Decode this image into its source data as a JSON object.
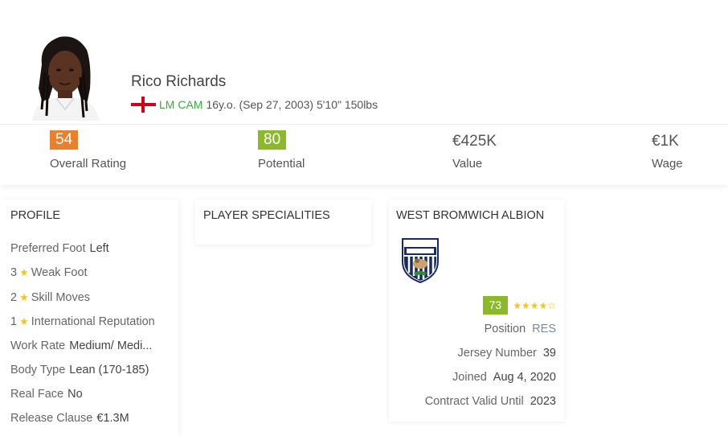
{
  "player": {
    "name": "Rico Richards",
    "positions": "LM CAM",
    "details": "16y.o. (Sep 27, 2003) 5'10\" 150lbs",
    "nationality_flag": "england-flag-icon"
  },
  "stats": {
    "overall": {
      "value": "54",
      "label": "Overall Rating",
      "color": "#e8812f"
    },
    "potential": {
      "value": "80",
      "label": "Potential",
      "color": "#8cb82c"
    },
    "value": {
      "value": "€425K",
      "label": "Value"
    },
    "wage": {
      "value": "€1K",
      "label": "Wage"
    }
  },
  "profile": {
    "title": "PROFILE",
    "preferred_foot": {
      "label": "Preferred Foot",
      "value": "Left"
    },
    "weak_foot": {
      "num": "3",
      "label": "Weak Foot"
    },
    "skill_moves": {
      "num": "2",
      "label": "Skill Moves"
    },
    "intl_rep": {
      "num": "1",
      "label": "International Reputation"
    },
    "work_rate": {
      "label": "Work Rate",
      "value": "Medium/ Medi..."
    },
    "body_type": {
      "label": "Body Type",
      "value": "Lean (170-185)"
    },
    "real_face": {
      "label": "Real Face",
      "value": "No"
    },
    "release_clause": {
      "label": "Release Clause",
      "value": "€1.3M"
    }
  },
  "specialities": {
    "title": "PLAYER SPECIALITIES"
  },
  "club": {
    "title": "WEST BROMWICH ALBION",
    "rating": "73",
    "stars": "★★★★☆",
    "position": {
      "label": "Position",
      "value": "RES"
    },
    "jersey": {
      "label": "Jersey Number",
      "value": "39"
    },
    "joined": {
      "label": "Joined",
      "value": "Aug 4, 2020"
    },
    "contract": {
      "label": "Contract Valid Until",
      "value": "2023"
    }
  }
}
